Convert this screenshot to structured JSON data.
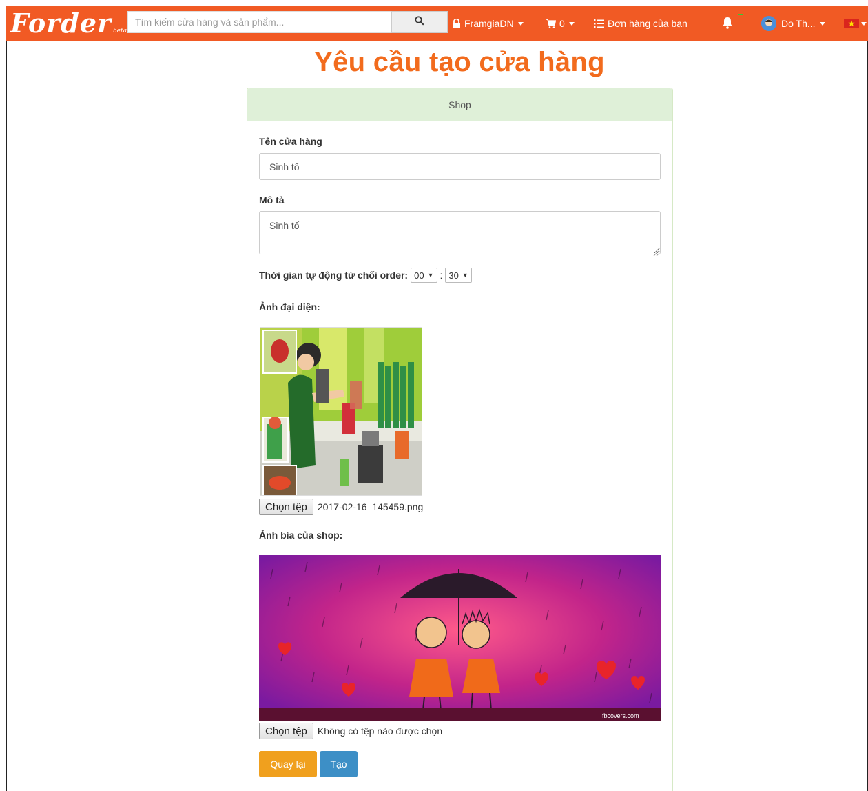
{
  "colors": {
    "navbar": "#f15a24",
    "title": "#f26b1d",
    "panel_heading": "#dff0d8",
    "back_button": "#f0a01e",
    "create_button": "#3d8fc6"
  },
  "navbar": {
    "logo_text": "Forder",
    "logo_tag": "beta",
    "search_placeholder": "Tìm kiếm cửa hàng và sản phẩm...",
    "search_icon": "search-icon",
    "workspace": "FramgiaDN",
    "cart_count": "0",
    "orders_label": "Đơn hàng của bạn",
    "user_name": "Do Th...",
    "language_flag": "vietnam-flag-icon"
  },
  "page": {
    "title": "Yêu cầu tạo cửa hàng",
    "panel_title": "Shop"
  },
  "form": {
    "name_label": "Tên cửa hàng",
    "name_value": "Sinh tố",
    "description_label": "Mô tả",
    "description_value": "Sinh tố",
    "auto_reject_label": "Thời gian tự động từ chối order:",
    "hour_value": "00",
    "time_separator": ":",
    "minute_value": "30",
    "avatar_label": "Ảnh đại diện:",
    "avatar_file_button": "Chọn tệp",
    "avatar_file_name": "2017-02-16_145459.png",
    "cover_label": "Ảnh bìa của shop:",
    "cover_file_button": "Chọn tệp",
    "cover_file_name": "Không có tệp nào được chọn",
    "cover_watermark": "fbcovers.com",
    "back_button": "Quay lại",
    "create_button": "Tạo"
  }
}
